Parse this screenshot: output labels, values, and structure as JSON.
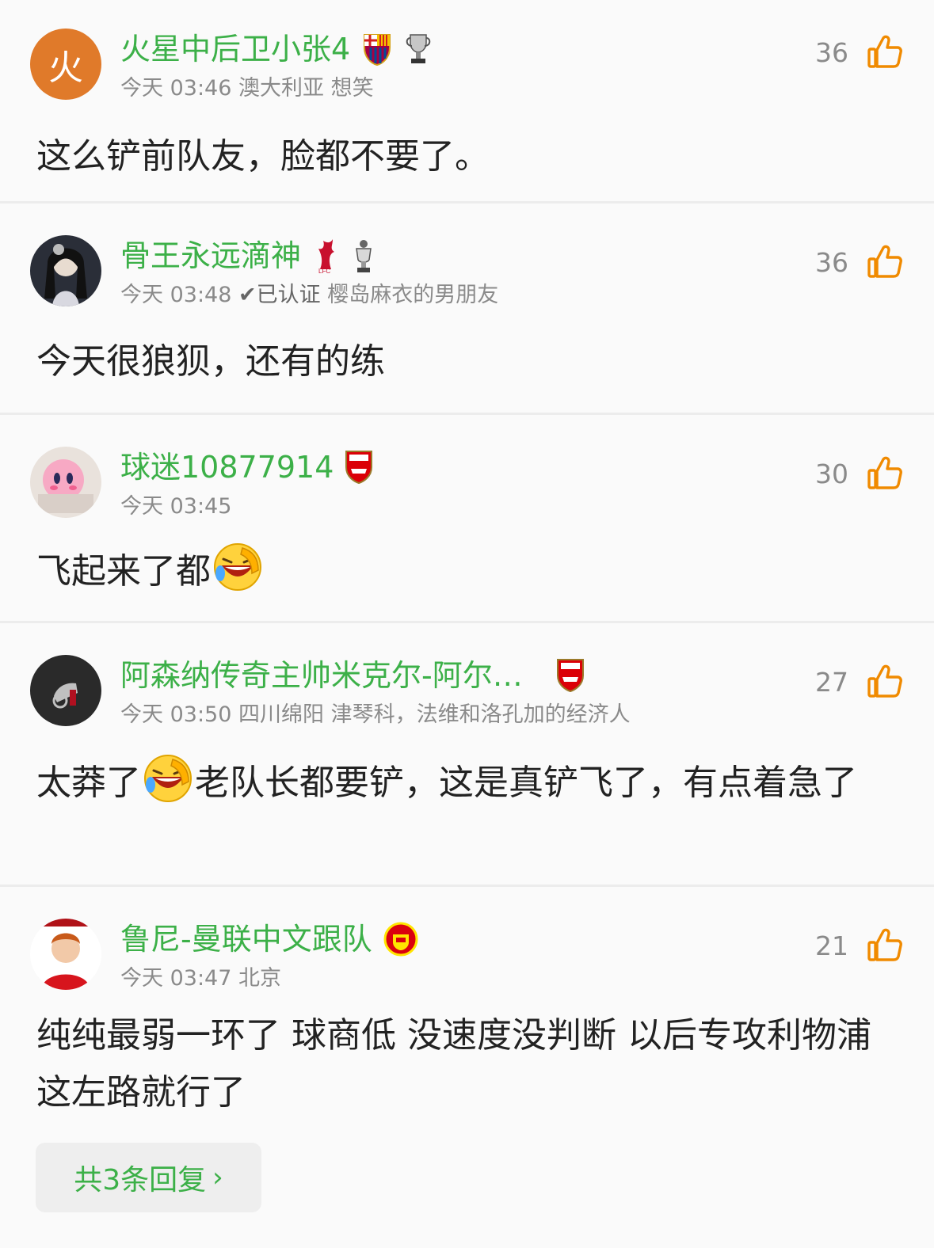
{
  "comments": [
    {
      "avatar_text": "火",
      "username": "火星中后卫小张4",
      "badges": [
        "barcelona-badge-icon",
        "trophy-badge-icon"
      ],
      "time": "今天 03:46",
      "location": "澳大利亚",
      "tag": "想笑",
      "likes": "36",
      "text": "这么铲前队友，脸都不要了。"
    },
    {
      "username": "骨王永远滴神",
      "badges": [
        "liverpool-badge-icon",
        "premier-league-trophy-icon"
      ],
      "time": "今天 03:48",
      "verified": "✔已认证",
      "tag": "樱岛麻衣的男朋友",
      "likes": "36",
      "text": "今天很狼狈，还有的练"
    },
    {
      "username": "球迷10877914",
      "badges": [
        "arsenal-badge-icon"
      ],
      "time": "今天 03:45",
      "likes": "30",
      "text": "飞起来了都",
      "emoji": "laughing-crying-emoji"
    },
    {
      "username": "阿森纳传奇主帅米克尔-阿尔…",
      "badges": [
        "arsenal-badge-icon"
      ],
      "time": "今天 03:50",
      "location": "四川绵阳",
      "tag": "津琴科，法维和洛孔加的经济人",
      "likes": "27",
      "text_before": "太莽了",
      "emoji": "laughing-crying-emoji",
      "text_after": "老队长都要铲，这是真铲飞了，有点着急了"
    },
    {
      "username": "鲁尼-曼联中文跟队",
      "badges": [
        "manchester-united-badge-icon"
      ],
      "time": "今天 03:47",
      "location": "北京",
      "likes": "21",
      "text": "纯纯最弱一环了 球商低 没速度没判断 以后专攻利物浦这左路就行了",
      "replies_label": "共3条回复"
    }
  ],
  "colors": {
    "username": "#3cb048",
    "like_icon": "#f08a00",
    "meta": "#8a8a8a"
  }
}
